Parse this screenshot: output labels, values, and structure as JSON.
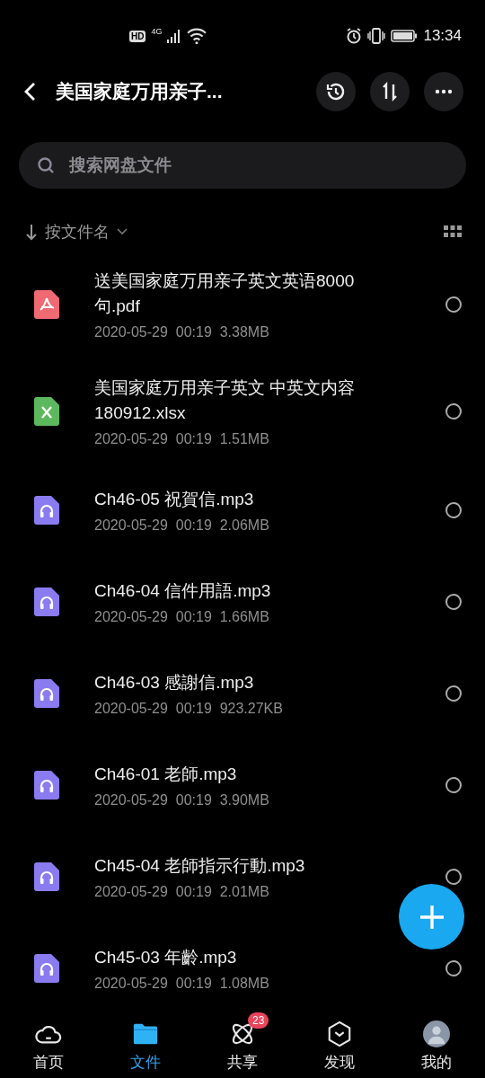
{
  "status_bar": {
    "network_badge": "HD",
    "network_type": "4G",
    "time": "13:34"
  },
  "header": {
    "title": "美国家庭万用亲子..."
  },
  "search": {
    "placeholder": "搜索网盘文件"
  },
  "sort": {
    "label": "按文件名"
  },
  "files": [
    {
      "kind": "pdf",
      "name": "送美国家庭万用亲子英文英语8000句.pdf",
      "date": "2020-05-29",
      "time": "00:19",
      "size": "3.38MB",
      "selected": false
    },
    {
      "kind": "sheet",
      "name": "美国家庭万用亲子英文 中英文内容180912.xlsx",
      "date": "2020-05-29",
      "time": "00:19",
      "size": "1.51MB",
      "selected": false
    },
    {
      "kind": "audio",
      "name": "Ch46-05 祝賀信.mp3",
      "date": "2020-05-29",
      "time": "00:19",
      "size": "2.06MB",
      "selected": false
    },
    {
      "kind": "audio",
      "name": "Ch46-04 信件用語.mp3",
      "date": "2020-05-29",
      "time": "00:19",
      "size": "1.66MB",
      "selected": false
    },
    {
      "kind": "audio",
      "name": "Ch46-03 感謝信.mp3",
      "date": "2020-05-29",
      "time": "00:19",
      "size": "923.27KB",
      "selected": false
    },
    {
      "kind": "audio",
      "name": "Ch46-01 老師.mp3",
      "date": "2020-05-29",
      "time": "00:19",
      "size": "3.90MB",
      "selected": false
    },
    {
      "kind": "audio",
      "name": "Ch45-04 老師指示行動.mp3",
      "date": "2020-05-29",
      "time": "00:19",
      "size": "2.01MB",
      "selected": false
    },
    {
      "kind": "audio",
      "name": "Ch45-03 年齡.mp3",
      "date": "2020-05-29",
      "time": "00:19",
      "size": "1.08MB",
      "selected": false
    }
  ],
  "nav": [
    {
      "kind": "cloud",
      "label": "首页",
      "selected": false
    },
    {
      "kind": "folder",
      "label": "文件",
      "selected": true
    },
    {
      "kind": "atom",
      "label": "共享",
      "selected": false,
      "badge": "23"
    },
    {
      "kind": "cube",
      "label": "发现",
      "selected": false
    },
    {
      "kind": "avatar",
      "label": "我的",
      "selected": false
    }
  ]
}
